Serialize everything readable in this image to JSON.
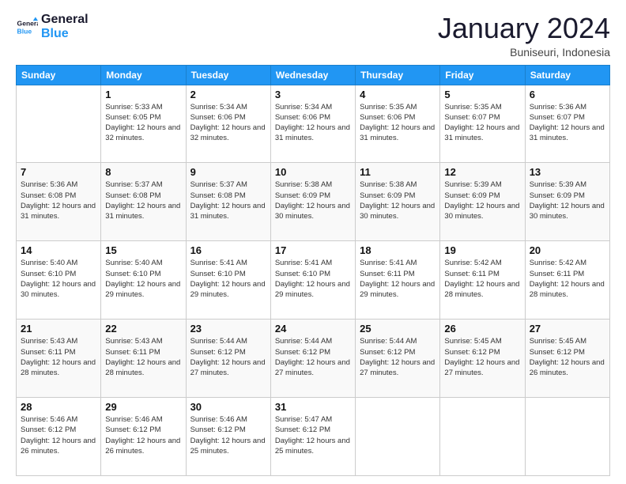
{
  "logo": {
    "line1": "General",
    "line2": "Blue"
  },
  "title": "January 2024",
  "location": "Buniseuri, Indonesia",
  "header_days": [
    "Sunday",
    "Monday",
    "Tuesday",
    "Wednesday",
    "Thursday",
    "Friday",
    "Saturday"
  ],
  "weeks": [
    [
      {
        "day": "",
        "sunrise": "",
        "sunset": "",
        "daylight": ""
      },
      {
        "day": "1",
        "sunrise": "Sunrise: 5:33 AM",
        "sunset": "Sunset: 6:05 PM",
        "daylight": "Daylight: 12 hours and 32 minutes."
      },
      {
        "day": "2",
        "sunrise": "Sunrise: 5:34 AM",
        "sunset": "Sunset: 6:06 PM",
        "daylight": "Daylight: 12 hours and 32 minutes."
      },
      {
        "day": "3",
        "sunrise": "Sunrise: 5:34 AM",
        "sunset": "Sunset: 6:06 PM",
        "daylight": "Daylight: 12 hours and 31 minutes."
      },
      {
        "day": "4",
        "sunrise": "Sunrise: 5:35 AM",
        "sunset": "Sunset: 6:06 PM",
        "daylight": "Daylight: 12 hours and 31 minutes."
      },
      {
        "day": "5",
        "sunrise": "Sunrise: 5:35 AM",
        "sunset": "Sunset: 6:07 PM",
        "daylight": "Daylight: 12 hours and 31 minutes."
      },
      {
        "day": "6",
        "sunrise": "Sunrise: 5:36 AM",
        "sunset": "Sunset: 6:07 PM",
        "daylight": "Daylight: 12 hours and 31 minutes."
      }
    ],
    [
      {
        "day": "7",
        "sunrise": "Sunrise: 5:36 AM",
        "sunset": "Sunset: 6:08 PM",
        "daylight": "Daylight: 12 hours and 31 minutes."
      },
      {
        "day": "8",
        "sunrise": "Sunrise: 5:37 AM",
        "sunset": "Sunset: 6:08 PM",
        "daylight": "Daylight: 12 hours and 31 minutes."
      },
      {
        "day": "9",
        "sunrise": "Sunrise: 5:37 AM",
        "sunset": "Sunset: 6:08 PM",
        "daylight": "Daylight: 12 hours and 31 minutes."
      },
      {
        "day": "10",
        "sunrise": "Sunrise: 5:38 AM",
        "sunset": "Sunset: 6:09 PM",
        "daylight": "Daylight: 12 hours and 30 minutes."
      },
      {
        "day": "11",
        "sunrise": "Sunrise: 5:38 AM",
        "sunset": "Sunset: 6:09 PM",
        "daylight": "Daylight: 12 hours and 30 minutes."
      },
      {
        "day": "12",
        "sunrise": "Sunrise: 5:39 AM",
        "sunset": "Sunset: 6:09 PM",
        "daylight": "Daylight: 12 hours and 30 minutes."
      },
      {
        "day": "13",
        "sunrise": "Sunrise: 5:39 AM",
        "sunset": "Sunset: 6:09 PM",
        "daylight": "Daylight: 12 hours and 30 minutes."
      }
    ],
    [
      {
        "day": "14",
        "sunrise": "Sunrise: 5:40 AM",
        "sunset": "Sunset: 6:10 PM",
        "daylight": "Daylight: 12 hours and 30 minutes."
      },
      {
        "day": "15",
        "sunrise": "Sunrise: 5:40 AM",
        "sunset": "Sunset: 6:10 PM",
        "daylight": "Daylight: 12 hours and 29 minutes."
      },
      {
        "day": "16",
        "sunrise": "Sunrise: 5:41 AM",
        "sunset": "Sunset: 6:10 PM",
        "daylight": "Daylight: 12 hours and 29 minutes."
      },
      {
        "day": "17",
        "sunrise": "Sunrise: 5:41 AM",
        "sunset": "Sunset: 6:10 PM",
        "daylight": "Daylight: 12 hours and 29 minutes."
      },
      {
        "day": "18",
        "sunrise": "Sunrise: 5:41 AM",
        "sunset": "Sunset: 6:11 PM",
        "daylight": "Daylight: 12 hours and 29 minutes."
      },
      {
        "day": "19",
        "sunrise": "Sunrise: 5:42 AM",
        "sunset": "Sunset: 6:11 PM",
        "daylight": "Daylight: 12 hours and 28 minutes."
      },
      {
        "day": "20",
        "sunrise": "Sunrise: 5:42 AM",
        "sunset": "Sunset: 6:11 PM",
        "daylight": "Daylight: 12 hours and 28 minutes."
      }
    ],
    [
      {
        "day": "21",
        "sunrise": "Sunrise: 5:43 AM",
        "sunset": "Sunset: 6:11 PM",
        "daylight": "Daylight: 12 hours and 28 minutes."
      },
      {
        "day": "22",
        "sunrise": "Sunrise: 5:43 AM",
        "sunset": "Sunset: 6:11 PM",
        "daylight": "Daylight: 12 hours and 28 minutes."
      },
      {
        "day": "23",
        "sunrise": "Sunrise: 5:44 AM",
        "sunset": "Sunset: 6:12 PM",
        "daylight": "Daylight: 12 hours and 27 minutes."
      },
      {
        "day": "24",
        "sunrise": "Sunrise: 5:44 AM",
        "sunset": "Sunset: 6:12 PM",
        "daylight": "Daylight: 12 hours and 27 minutes."
      },
      {
        "day": "25",
        "sunrise": "Sunrise: 5:44 AM",
        "sunset": "Sunset: 6:12 PM",
        "daylight": "Daylight: 12 hours and 27 minutes."
      },
      {
        "day": "26",
        "sunrise": "Sunrise: 5:45 AM",
        "sunset": "Sunset: 6:12 PM",
        "daylight": "Daylight: 12 hours and 27 minutes."
      },
      {
        "day": "27",
        "sunrise": "Sunrise: 5:45 AM",
        "sunset": "Sunset: 6:12 PM",
        "daylight": "Daylight: 12 hours and 26 minutes."
      }
    ],
    [
      {
        "day": "28",
        "sunrise": "Sunrise: 5:46 AM",
        "sunset": "Sunset: 6:12 PM",
        "daylight": "Daylight: 12 hours and 26 minutes."
      },
      {
        "day": "29",
        "sunrise": "Sunrise: 5:46 AM",
        "sunset": "Sunset: 6:12 PM",
        "daylight": "Daylight: 12 hours and 26 minutes."
      },
      {
        "day": "30",
        "sunrise": "Sunrise: 5:46 AM",
        "sunset": "Sunset: 6:12 PM",
        "daylight": "Daylight: 12 hours and 25 minutes."
      },
      {
        "day": "31",
        "sunrise": "Sunrise: 5:47 AM",
        "sunset": "Sunset: 6:12 PM",
        "daylight": "Daylight: 12 hours and 25 minutes."
      },
      {
        "day": "",
        "sunrise": "",
        "sunset": "",
        "daylight": ""
      },
      {
        "day": "",
        "sunrise": "",
        "sunset": "",
        "daylight": ""
      },
      {
        "day": "",
        "sunrise": "",
        "sunset": "",
        "daylight": ""
      }
    ]
  ]
}
